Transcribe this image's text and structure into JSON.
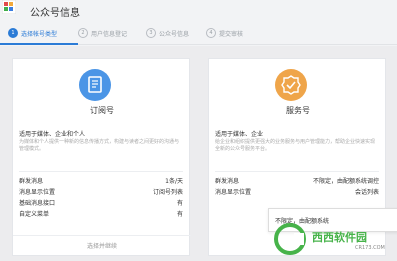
{
  "header": {
    "title": "公众号信息"
  },
  "steps": [
    {
      "num": "1",
      "label": "选择帐号类型"
    },
    {
      "num": "2",
      "label": "用户信息登记"
    },
    {
      "num": "3",
      "label": "公众号信息"
    },
    {
      "num": "4",
      "label": "提交审核"
    }
  ],
  "cards": [
    {
      "title": "订阅号",
      "subtitle": "适用于媒体、企业和个人",
      "desc": "为媒体和个人提供一种新的信息传播方式，构建与读者之间更好的沟通与管理模式。",
      "rows": [
        {
          "k": "群发消息",
          "v": "1条/天"
        },
        {
          "k": "消息显示位置",
          "v": "订阅号列表"
        },
        {
          "k": "基础消息接口",
          "v": "有"
        },
        {
          "k": "自定义菜单",
          "v": "有"
        }
      ],
      "action": "选择并继续"
    },
    {
      "title": "服务号",
      "subtitle": "适用于媒体、企业",
      "desc": "给企业和组织提供更强大的业务服务与用户管理能力，帮助企业快速实现全新的公众号服务平台。",
      "rows": [
        {
          "k": "群发消息",
          "v": "不限定，由配额系统调控"
        },
        {
          "k": "消息显示位置",
          "v": "会话列表"
        }
      ],
      "action": ""
    }
  ],
  "popup": {
    "text": "不限定，由配额系统"
  },
  "watermark": {
    "name": "西西软件园",
    "url": "CR173.COM"
  },
  "colors": {
    "accent": "#2b7bd6",
    "subscription_badge": "#4b95e6",
    "service_badge": "#efa54a",
    "watermark_green": "#47b34a"
  }
}
